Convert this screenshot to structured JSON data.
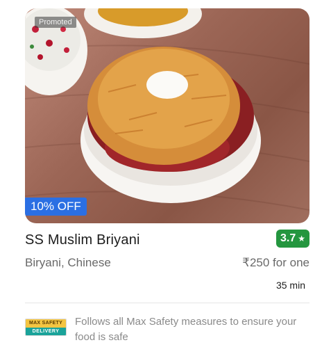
{
  "restaurant": {
    "promoted_label": "Promoted",
    "discount": "10% OFF",
    "name": "SS Muslim Briyani",
    "rating": "3.7",
    "rating_icon": "star-icon",
    "cuisine": "Biryani, Chinese",
    "price": "₹250 for one",
    "delivery_time": "35 min",
    "rating_color": "#24963f",
    "discount_color": "#2b6fe3"
  },
  "safety": {
    "badge_top": "MAX SAFETY",
    "badge_bottom": "DELIVERY",
    "text": "Follows all Max Safety measures to ensure your food is safe"
  }
}
